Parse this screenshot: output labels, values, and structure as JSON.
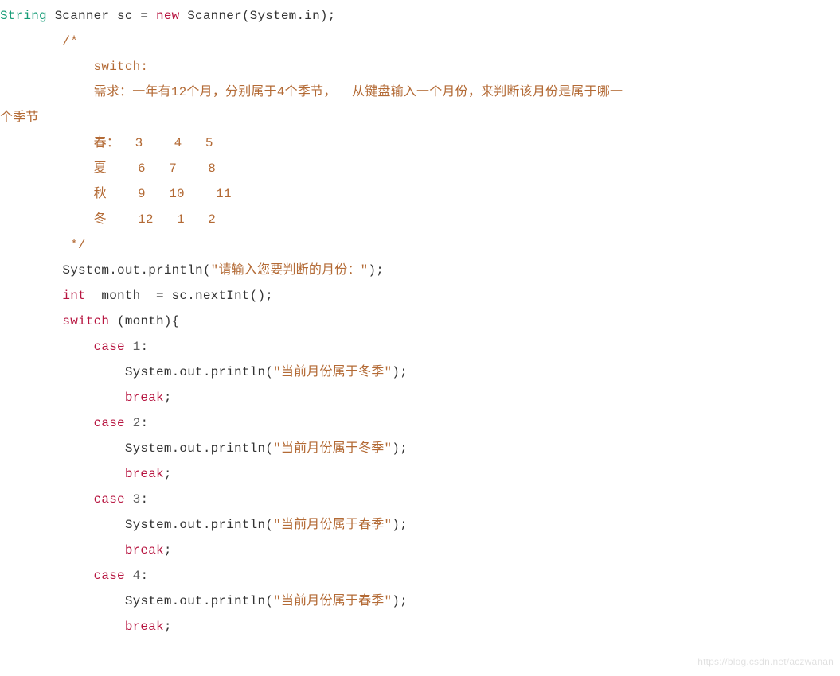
{
  "code": {
    "line1": {
      "type": "String",
      "decl1": " Scanner sc = ",
      "kw_new": "new",
      "rest": " Scanner(System.in);"
    },
    "comment": {
      "open": "        /*",
      "l1": "            switch:",
      "l2": "            需求：一年有12个月，分别属于4个季节，  从键盘输入一个月份，来判断该月份是属于哪一",
      "l2b": "个季节",
      "l3": "            春：  3    4   5",
      "l4": "            夏    6   7    8",
      "l5": "            秋    9   10    11",
      "l6": "            冬    12   1   2",
      "close": "         */"
    },
    "line_print_prompt": {
      "pre": "        System.out.println(",
      "str": "\"请输入您要判断的月份：\"",
      "post": ");"
    },
    "line_int": {
      "kw": "int",
      "rest": "  month  = sc.nextInt();"
    },
    "line_switch": {
      "kw": "switch",
      "rest": " (month){"
    },
    "cases": [
      {
        "case_kw": "case",
        "num": "1",
        "colon": ":",
        "println_pre": "                System.out.println(",
        "str": "\"当前月份属于冬季\"",
        "println_post": ");",
        "break": "break",
        "semi": ";"
      },
      {
        "case_kw": "case",
        "num": "2",
        "colon": ":",
        "println_pre": "                System.out.println(",
        "str": "\"当前月份属于冬季\"",
        "println_post": ");",
        "break": "break",
        "semi": ";"
      },
      {
        "case_kw": "case",
        "num": "3",
        "colon": ":",
        "println_pre": "                System.out.println(",
        "str": "\"当前月份属于春季\"",
        "println_post": ");",
        "break": "break",
        "semi": ";"
      },
      {
        "case_kw": "case",
        "num": "4",
        "colon": ":",
        "println_pre": "                System.out.println(",
        "str": "\"当前月份属于春季\"",
        "println_post": ");",
        "break": "break",
        "semi": ";"
      }
    ]
  },
  "watermark": "https://blog.csdn.net/aczwanan"
}
